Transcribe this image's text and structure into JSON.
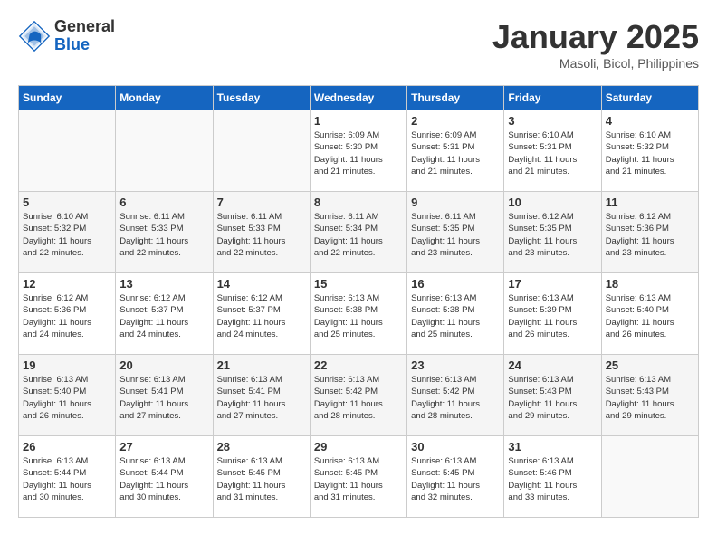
{
  "header": {
    "logo_general": "General",
    "logo_blue": "Blue",
    "month_title": "January 2025",
    "subtitle": "Masoli, Bicol, Philippines"
  },
  "days_of_week": [
    "Sunday",
    "Monday",
    "Tuesday",
    "Wednesday",
    "Thursday",
    "Friday",
    "Saturday"
  ],
  "weeks": [
    [
      {
        "day": "",
        "info": ""
      },
      {
        "day": "",
        "info": ""
      },
      {
        "day": "",
        "info": ""
      },
      {
        "day": "1",
        "info": "Sunrise: 6:09 AM\nSunset: 5:30 PM\nDaylight: 11 hours\nand 21 minutes."
      },
      {
        "day": "2",
        "info": "Sunrise: 6:09 AM\nSunset: 5:31 PM\nDaylight: 11 hours\nand 21 minutes."
      },
      {
        "day": "3",
        "info": "Sunrise: 6:10 AM\nSunset: 5:31 PM\nDaylight: 11 hours\nand 21 minutes."
      },
      {
        "day": "4",
        "info": "Sunrise: 6:10 AM\nSunset: 5:32 PM\nDaylight: 11 hours\nand 21 minutes."
      }
    ],
    [
      {
        "day": "5",
        "info": "Sunrise: 6:10 AM\nSunset: 5:32 PM\nDaylight: 11 hours\nand 22 minutes."
      },
      {
        "day": "6",
        "info": "Sunrise: 6:11 AM\nSunset: 5:33 PM\nDaylight: 11 hours\nand 22 minutes."
      },
      {
        "day": "7",
        "info": "Sunrise: 6:11 AM\nSunset: 5:33 PM\nDaylight: 11 hours\nand 22 minutes."
      },
      {
        "day": "8",
        "info": "Sunrise: 6:11 AM\nSunset: 5:34 PM\nDaylight: 11 hours\nand 22 minutes."
      },
      {
        "day": "9",
        "info": "Sunrise: 6:11 AM\nSunset: 5:35 PM\nDaylight: 11 hours\nand 23 minutes."
      },
      {
        "day": "10",
        "info": "Sunrise: 6:12 AM\nSunset: 5:35 PM\nDaylight: 11 hours\nand 23 minutes."
      },
      {
        "day": "11",
        "info": "Sunrise: 6:12 AM\nSunset: 5:36 PM\nDaylight: 11 hours\nand 23 minutes."
      }
    ],
    [
      {
        "day": "12",
        "info": "Sunrise: 6:12 AM\nSunset: 5:36 PM\nDaylight: 11 hours\nand 24 minutes."
      },
      {
        "day": "13",
        "info": "Sunrise: 6:12 AM\nSunset: 5:37 PM\nDaylight: 11 hours\nand 24 minutes."
      },
      {
        "day": "14",
        "info": "Sunrise: 6:12 AM\nSunset: 5:37 PM\nDaylight: 11 hours\nand 24 minutes."
      },
      {
        "day": "15",
        "info": "Sunrise: 6:13 AM\nSunset: 5:38 PM\nDaylight: 11 hours\nand 25 minutes."
      },
      {
        "day": "16",
        "info": "Sunrise: 6:13 AM\nSunset: 5:38 PM\nDaylight: 11 hours\nand 25 minutes."
      },
      {
        "day": "17",
        "info": "Sunrise: 6:13 AM\nSunset: 5:39 PM\nDaylight: 11 hours\nand 26 minutes."
      },
      {
        "day": "18",
        "info": "Sunrise: 6:13 AM\nSunset: 5:40 PM\nDaylight: 11 hours\nand 26 minutes."
      }
    ],
    [
      {
        "day": "19",
        "info": "Sunrise: 6:13 AM\nSunset: 5:40 PM\nDaylight: 11 hours\nand 26 minutes."
      },
      {
        "day": "20",
        "info": "Sunrise: 6:13 AM\nSunset: 5:41 PM\nDaylight: 11 hours\nand 27 minutes."
      },
      {
        "day": "21",
        "info": "Sunrise: 6:13 AM\nSunset: 5:41 PM\nDaylight: 11 hours\nand 27 minutes."
      },
      {
        "day": "22",
        "info": "Sunrise: 6:13 AM\nSunset: 5:42 PM\nDaylight: 11 hours\nand 28 minutes."
      },
      {
        "day": "23",
        "info": "Sunrise: 6:13 AM\nSunset: 5:42 PM\nDaylight: 11 hours\nand 28 minutes."
      },
      {
        "day": "24",
        "info": "Sunrise: 6:13 AM\nSunset: 5:43 PM\nDaylight: 11 hours\nand 29 minutes."
      },
      {
        "day": "25",
        "info": "Sunrise: 6:13 AM\nSunset: 5:43 PM\nDaylight: 11 hours\nand 29 minutes."
      }
    ],
    [
      {
        "day": "26",
        "info": "Sunrise: 6:13 AM\nSunset: 5:44 PM\nDaylight: 11 hours\nand 30 minutes."
      },
      {
        "day": "27",
        "info": "Sunrise: 6:13 AM\nSunset: 5:44 PM\nDaylight: 11 hours\nand 30 minutes."
      },
      {
        "day": "28",
        "info": "Sunrise: 6:13 AM\nSunset: 5:45 PM\nDaylight: 11 hours\nand 31 minutes."
      },
      {
        "day": "29",
        "info": "Sunrise: 6:13 AM\nSunset: 5:45 PM\nDaylight: 11 hours\nand 31 minutes."
      },
      {
        "day": "30",
        "info": "Sunrise: 6:13 AM\nSunset: 5:45 PM\nDaylight: 11 hours\nand 32 minutes."
      },
      {
        "day": "31",
        "info": "Sunrise: 6:13 AM\nSunset: 5:46 PM\nDaylight: 11 hours\nand 33 minutes."
      },
      {
        "day": "",
        "info": ""
      }
    ]
  ]
}
